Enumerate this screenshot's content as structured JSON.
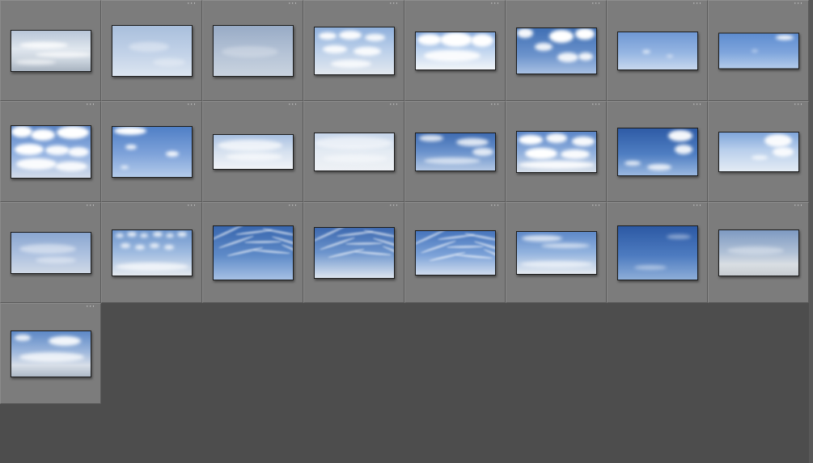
{
  "grid": {
    "columns": 8,
    "total": 25,
    "more_glyph": "···",
    "thumbnails": [
      {
        "sky": "overcast-wispy"
      },
      {
        "sky": "hazy-blue"
      },
      {
        "sky": "gray-haze"
      },
      {
        "sky": "scattered-cumulus"
      },
      {
        "sky": "bright-cumulus"
      },
      {
        "sky": "deep-blue-cumulus"
      },
      {
        "sky": "clear-light-blue"
      },
      {
        "sky": "clear-deep-blue"
      },
      {
        "sky": "dense-cumulus"
      },
      {
        "sky": "blue-small-clouds"
      },
      {
        "sky": "pale-overcast"
      },
      {
        "sky": "white-overcast"
      },
      {
        "sky": "blue-streaks"
      },
      {
        "sky": "puffy-cumulus"
      },
      {
        "sky": "deep-blue-scattered"
      },
      {
        "sky": "pale-scattered"
      },
      {
        "sky": "soft-haze"
      },
      {
        "sky": "altocumulus"
      },
      {
        "sky": "cirrus-blue"
      },
      {
        "sky": "cirrus-streaks"
      },
      {
        "sky": "cirrus-fan"
      },
      {
        "sky": "high-cirrus"
      },
      {
        "sky": "deep-blue-wisps"
      },
      {
        "sky": "gray-horizon"
      },
      {
        "sky": "blue-layered"
      }
    ]
  },
  "colors": {
    "background": "#4d4d4d",
    "cell": "#7c7c7c",
    "more_glyph": "#e6e6e6"
  }
}
